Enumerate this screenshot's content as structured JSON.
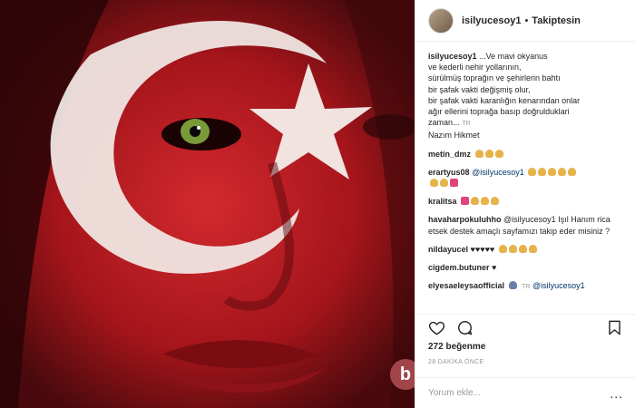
{
  "post": {
    "username": "isilyucesoy1",
    "follow_label": "Takiptesin",
    "watermark": "b"
  },
  "caption": {
    "username": "isilyucesoy1",
    "lines": [
      "...Ve mavi okyanus",
      "ve kederli nehir yollarının,",
      "sürülmüş toprağın ve şehirlerin bahtı",
      "bir şafak vakti değişmiş olur,",
      "bir şafak vakti karanlığın kenarından onlar",
      "ağır ellerini toprağa basıp doğrulduklari",
      "zaman...",
      "Nazım Hikmet"
    ],
    "translate_label": "TR"
  },
  "comments": [
    {
      "user": "metin_dmz",
      "text": ""
    },
    {
      "user": "erartyus08",
      "text": "@isilyucesoy1"
    },
    {
      "user": "kralitsa",
      "text": ""
    },
    {
      "user": "havaharpokuluhho",
      "text": "@isilyucesoy1 Işıl Hanım rica etsek destek amaçlı sayfamızı takip eder misiniz ?"
    },
    {
      "user": "nildayucel",
      "text": "♥♥♥♥♥"
    },
    {
      "user": "cigdem.butuner",
      "text": "♥"
    },
    {
      "user": "elyesaeleysaofficial",
      "text": "@isilyucesoy1",
      "translate_label": "TR"
    }
  ],
  "actions": {
    "icons": [
      "heart-icon",
      "comment-icon",
      "bookmark-icon"
    ]
  },
  "likes": "272 beğenme",
  "timestamp": "28 DAKİKA ÖNCE",
  "add_comment": {
    "placeholder": "Yorum ekle...",
    "more_label": "..."
  }
}
